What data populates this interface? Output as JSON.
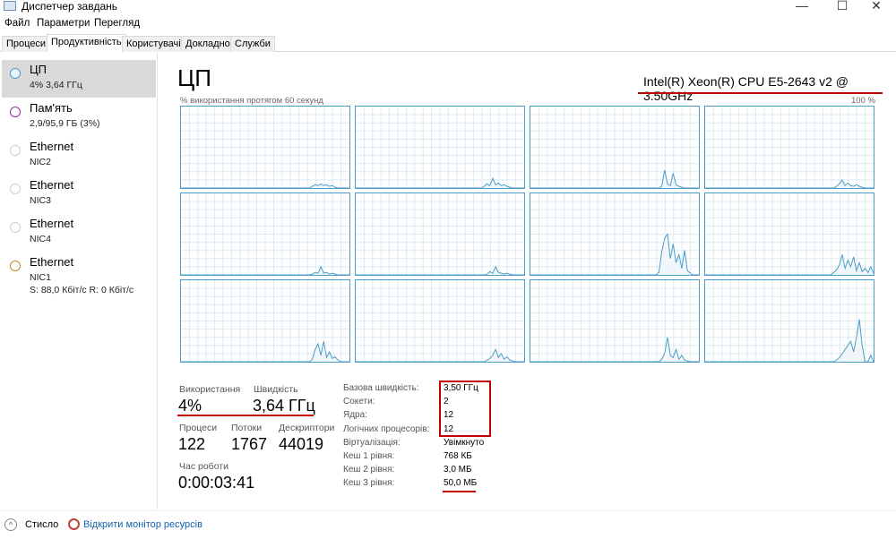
{
  "window": {
    "title": "Диспетчер завдань",
    "minimize": "—",
    "maximize": "☐",
    "close": "✕"
  },
  "menu": [
    "Файл",
    "Параметри",
    "Перегляд"
  ],
  "tabs": [
    "Процеси",
    "Продуктивність",
    "Користувачі",
    "Докладно",
    "Служби"
  ],
  "sidebar": [
    {
      "name": "ЦП",
      "sub": "4% 3,64 ГГц",
      "color": "#4a9cc8"
    },
    {
      "name": "Пам'ять",
      "sub": "2,9/95,9 ГБ (3%)",
      "color": "#9b2ba8"
    },
    {
      "name": "Ethernet",
      "sub": "NIC2",
      "color": "#cfcfcf"
    },
    {
      "name": "Ethernet",
      "sub": "NIC3",
      "color": "#cfcfcf"
    },
    {
      "name": "Ethernet",
      "sub": "NIC4",
      "color": "#cfcfcf"
    },
    {
      "name": "Ethernet",
      "sub": "NIC1",
      "sub2": "S: 88,0 Кбіт/с R: 0 Кбіт/с",
      "color": "#c8842a"
    }
  ],
  "main": {
    "title": "ЦП",
    "model": "Intel(R) Xeon(R) CPU E5-2643 v2 @ 3.50GHz",
    "graph_label": "% використання протягом 60 секунд",
    "graph_max": "100 %",
    "usage_label": "Використання",
    "usage": "4%",
    "speed_label": "Швидкість",
    "speed": "3,64 ГГц",
    "proc_label": "Процеси",
    "proc": "122",
    "threads_label": "Потоки",
    "threads": "1767",
    "handles_label": "Дескриптори",
    "handles": "44019",
    "uptime_label": "Час роботи",
    "uptime": "0:00:03:41",
    "details": [
      {
        "k": "Базова швидкість:",
        "v": "3,50 ГГц"
      },
      {
        "k": "Сокети:",
        "v": "2"
      },
      {
        "k": "Ядра:",
        "v": "12"
      },
      {
        "k": "Логічних процесорів:",
        "v": "12"
      },
      {
        "k": "Віртуалізація:",
        "v": "Увімкнуто"
      },
      {
        "k": "Кеш 1 рівня:",
        "v": "768 КБ"
      },
      {
        "k": "Кеш 2 рівня:",
        "v": "3,0 МБ"
      },
      {
        "k": "Кеш 3 рівня:",
        "v": "50,0 МБ"
      }
    ],
    "graphs": [
      [
        0,
        0,
        0,
        0,
        0,
        0,
        0,
        0,
        0,
        0,
        0,
        0,
        0,
        0,
        0,
        0,
        0,
        0,
        0,
        0,
        0,
        0,
        0,
        0,
        0,
        0,
        0,
        0,
        0,
        0,
        0,
        0,
        0,
        0,
        0,
        0,
        0,
        0,
        0,
        0,
        0,
        0,
        0,
        0,
        0,
        0,
        2,
        4,
        3,
        5,
        3,
        4,
        2,
        3,
        1,
        0,
        0,
        0,
        0,
        0
      ],
      [
        0,
        0,
        0,
        0,
        0,
        0,
        0,
        0,
        0,
        0,
        0,
        0,
        0,
        0,
        0,
        0,
        0,
        0,
        0,
        0,
        0,
        0,
        0,
        0,
        0,
        0,
        0,
        0,
        0,
        0,
        0,
        0,
        0,
        0,
        0,
        0,
        0,
        0,
        0,
        0,
        0,
        0,
        0,
        0,
        0,
        2,
        5,
        3,
        12,
        4,
        6,
        3,
        4,
        2,
        1,
        0,
        0,
        0,
        0,
        0
      ],
      [
        0,
        0,
        0,
        0,
        0,
        0,
        0,
        0,
        0,
        0,
        0,
        0,
        0,
        0,
        0,
        0,
        0,
        0,
        0,
        0,
        0,
        0,
        0,
        0,
        0,
        0,
        0,
        0,
        0,
        0,
        0,
        0,
        0,
        0,
        0,
        0,
        0,
        0,
        0,
        0,
        0,
        0,
        0,
        0,
        0,
        0,
        2,
        22,
        5,
        3,
        18,
        4,
        2,
        1,
        0,
        0,
        0,
        0,
        0,
        0
      ],
      [
        0,
        0,
        0,
        0,
        0,
        0,
        0,
        0,
        0,
        0,
        0,
        0,
        0,
        0,
        0,
        0,
        0,
        0,
        0,
        0,
        0,
        0,
        0,
        0,
        0,
        0,
        0,
        0,
        0,
        0,
        0,
        0,
        0,
        0,
        0,
        0,
        0,
        0,
        0,
        0,
        0,
        0,
        0,
        0,
        0,
        0,
        2,
        5,
        10,
        3,
        6,
        3,
        2,
        4,
        2,
        1,
        0,
        0,
        0,
        0
      ],
      [
        0,
        0,
        0,
        0,
        0,
        0,
        0,
        0,
        0,
        0,
        0,
        0,
        0,
        0,
        0,
        0,
        0,
        0,
        0,
        0,
        0,
        0,
        0,
        0,
        0,
        0,
        0,
        0,
        0,
        0,
        0,
        0,
        0,
        0,
        0,
        0,
        0,
        0,
        0,
        0,
        0,
        0,
        0,
        0,
        0,
        0,
        1,
        3,
        2,
        10,
        2,
        3,
        1,
        2,
        1,
        0,
        0,
        0,
        0,
        0
      ],
      [
        0,
        0,
        0,
        0,
        0,
        0,
        0,
        0,
        0,
        0,
        0,
        0,
        0,
        0,
        0,
        0,
        0,
        0,
        0,
        0,
        0,
        0,
        0,
        0,
        0,
        0,
        0,
        0,
        0,
        0,
        0,
        0,
        0,
        0,
        0,
        0,
        0,
        0,
        0,
        0,
        0,
        0,
        0,
        0,
        0,
        0,
        1,
        4,
        2,
        10,
        3,
        2,
        1,
        2,
        1,
        0,
        0,
        0,
        0,
        0
      ],
      [
        0,
        0,
        0,
        0,
        0,
        0,
        0,
        0,
        0,
        0,
        0,
        0,
        0,
        0,
        0,
        0,
        0,
        0,
        0,
        0,
        0,
        0,
        0,
        0,
        0,
        0,
        0,
        0,
        0,
        0,
        0,
        0,
        0,
        0,
        0,
        0,
        0,
        0,
        0,
        0,
        0,
        0,
        0,
        0,
        0,
        3,
        28,
        45,
        50,
        20,
        38,
        15,
        25,
        8,
        30,
        5,
        2,
        0,
        0,
        0
      ],
      [
        0,
        0,
        0,
        0,
        0,
        0,
        0,
        0,
        0,
        0,
        0,
        0,
        0,
        0,
        0,
        0,
        0,
        0,
        0,
        0,
        0,
        0,
        0,
        0,
        0,
        0,
        0,
        0,
        0,
        0,
        0,
        0,
        0,
        0,
        0,
        0,
        0,
        0,
        0,
        0,
        0,
        0,
        0,
        0,
        0,
        3,
        6,
        12,
        25,
        8,
        18,
        10,
        22,
        5,
        15,
        4,
        8,
        3,
        10,
        2
      ],
      [
        0,
        0,
        0,
        0,
        0,
        0,
        0,
        0,
        0,
        0,
        0,
        0,
        0,
        0,
        0,
        0,
        0,
        0,
        0,
        0,
        0,
        0,
        0,
        0,
        0,
        0,
        0,
        0,
        0,
        0,
        0,
        0,
        0,
        0,
        0,
        0,
        0,
        0,
        0,
        0,
        0,
        0,
        0,
        0,
        0,
        0,
        3,
        15,
        22,
        8,
        25,
        5,
        12,
        4,
        6,
        2,
        0,
        0,
        0,
        0
      ],
      [
        0,
        0,
        0,
        0,
        0,
        0,
        0,
        0,
        0,
        0,
        0,
        0,
        0,
        0,
        0,
        0,
        0,
        0,
        0,
        0,
        0,
        0,
        0,
        0,
        0,
        0,
        0,
        0,
        0,
        0,
        0,
        0,
        0,
        0,
        0,
        0,
        0,
        0,
        0,
        0,
        0,
        0,
        0,
        0,
        0,
        0,
        2,
        4,
        8,
        15,
        5,
        10,
        3,
        6,
        2,
        1,
        0,
        0,
        0,
        0
      ],
      [
        0,
        0,
        0,
        0,
        0,
        0,
        0,
        0,
        0,
        0,
        0,
        0,
        0,
        0,
        0,
        0,
        0,
        0,
        0,
        0,
        0,
        0,
        0,
        0,
        0,
        0,
        0,
        0,
        0,
        0,
        0,
        0,
        0,
        0,
        0,
        0,
        0,
        0,
        0,
        0,
        0,
        0,
        0,
        0,
        0,
        0,
        3,
        10,
        30,
        8,
        5,
        15,
        3,
        8,
        2,
        1,
        0,
        0,
        0,
        0
      ],
      [
        0,
        0,
        0,
        0,
        0,
        0,
        0,
        0,
        0,
        0,
        0,
        0,
        0,
        0,
        0,
        0,
        0,
        0,
        0,
        0,
        0,
        0,
        0,
        0,
        0,
        0,
        0,
        0,
        0,
        0,
        0,
        0,
        0,
        0,
        0,
        0,
        0,
        0,
        0,
        0,
        0,
        0,
        0,
        0,
        0,
        0,
        2,
        5,
        10,
        15,
        20,
        25,
        12,
        30,
        52,
        20,
        0,
        0,
        8,
        0
      ]
    ]
  },
  "footer": {
    "collapse": "Стисло",
    "monitor": "Відкрити монітор ресурсів"
  }
}
